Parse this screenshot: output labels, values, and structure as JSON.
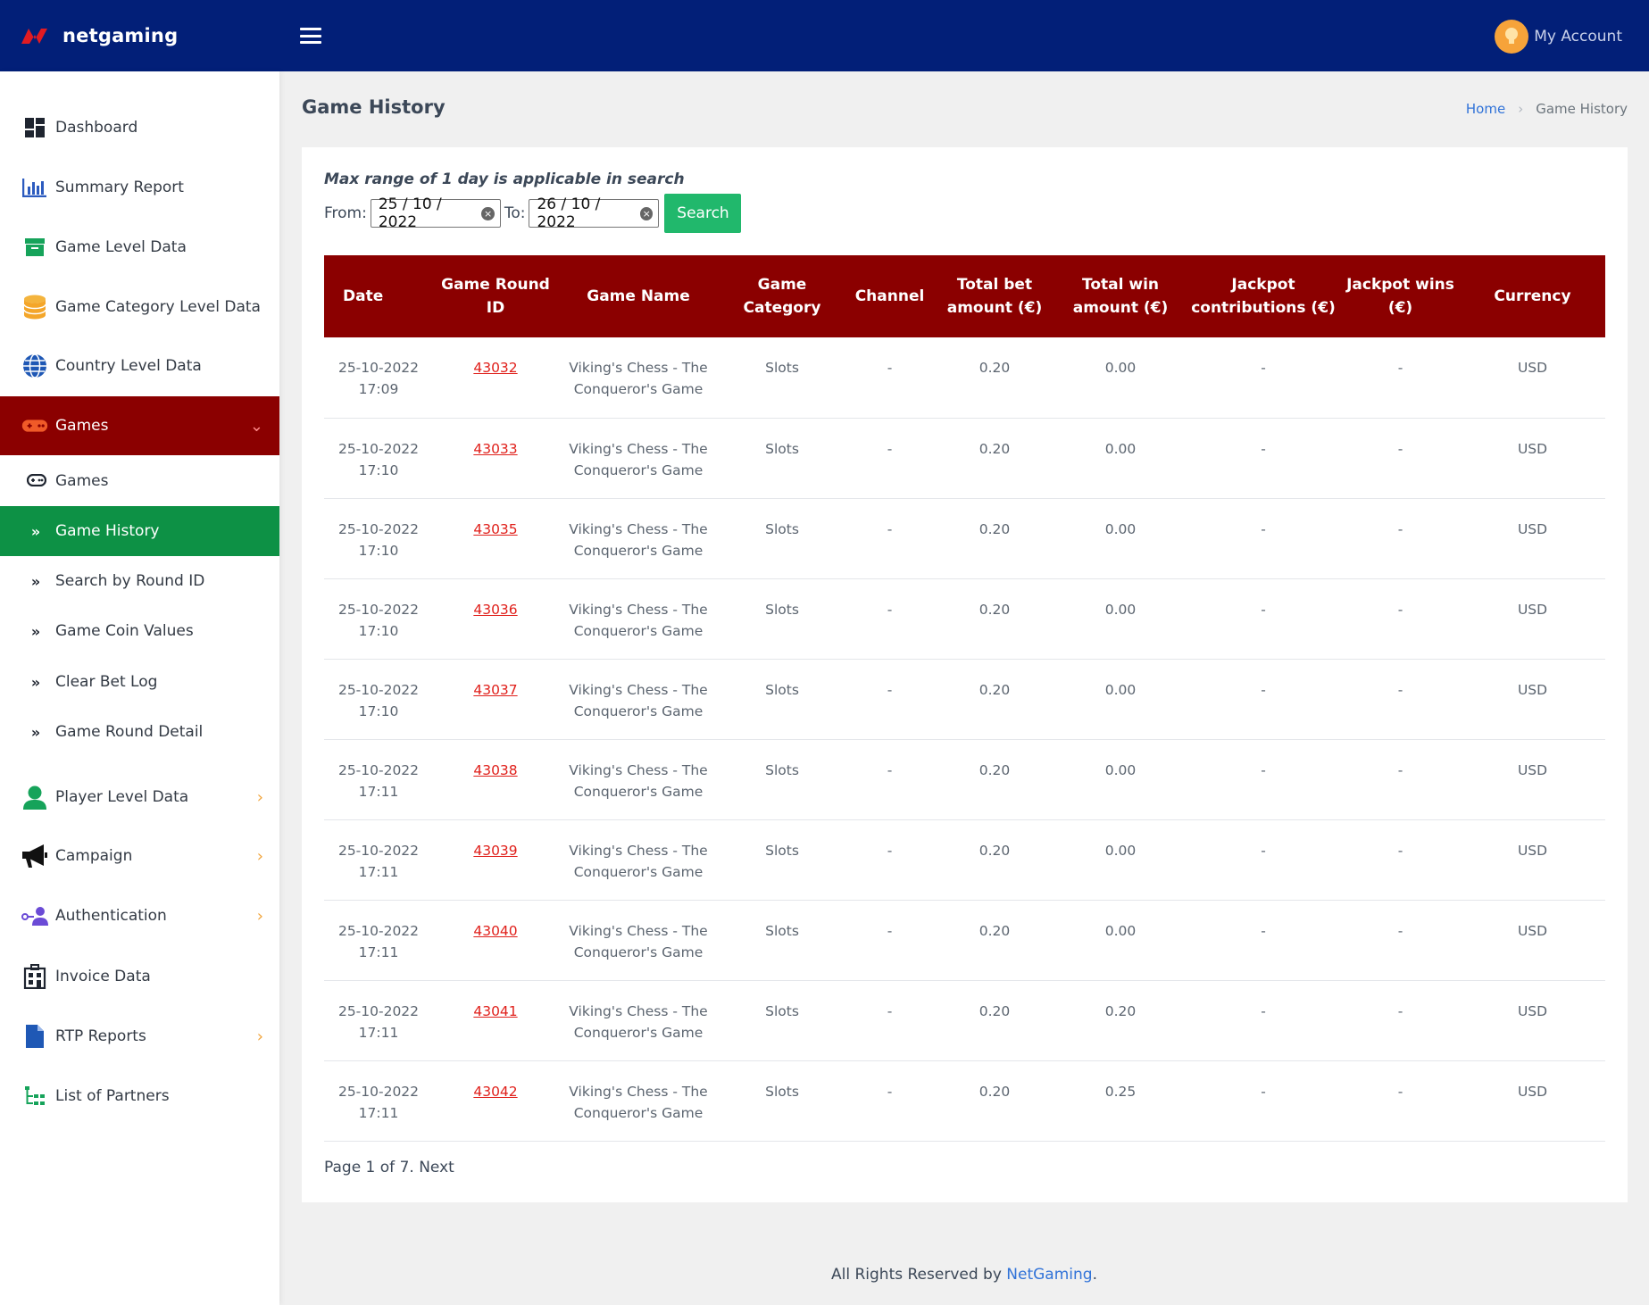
{
  "header": {
    "brand": "netgaming",
    "account_label": "My Account"
  },
  "sidebar": {
    "items": [
      {
        "label": "Dashboard",
        "icon": "dashboard-icon"
      },
      {
        "label": "Summary Report",
        "icon": "bar-chart-icon"
      },
      {
        "label": "Game Level Data",
        "icon": "archive-box-icon"
      },
      {
        "label": "Game Category Level Data",
        "icon": "database-icon"
      },
      {
        "label": "Country Level Data",
        "icon": "globe-icon"
      },
      {
        "label": "Games",
        "icon": "gamepad-icon"
      },
      {
        "label": "Player Level Data",
        "icon": "user-icon"
      },
      {
        "label": "Campaign",
        "icon": "megaphone-icon"
      },
      {
        "label": "Authentication",
        "icon": "user-key-icon"
      },
      {
        "label": "Invoice Data",
        "icon": "building-icon"
      },
      {
        "label": "RTP Reports",
        "icon": "document-icon"
      },
      {
        "label": "List of Partners",
        "icon": "sitemap-icon"
      }
    ],
    "sub_items": [
      {
        "label": "Games",
        "icon": "gamepad-icon"
      },
      {
        "label": "Game History",
        "icon": "double-chevron-icon"
      },
      {
        "label": "Search by Round ID",
        "icon": "double-chevron-icon"
      },
      {
        "label": "Game Coin Values",
        "icon": "double-chevron-icon"
      },
      {
        "label": "Clear Bet Log",
        "icon": "double-chevron-icon"
      },
      {
        "label": "Game Round Detail",
        "icon": "double-chevron-icon"
      }
    ]
  },
  "page": {
    "title": "Game History",
    "breadcrumb": {
      "home": "Home",
      "current": "Game History"
    }
  },
  "filters": {
    "hint": "Max range of 1 day is applicable in search",
    "from_label": "From:",
    "from_value": "25 / 10 / 2022",
    "to_label": "To:",
    "to_value": "26 / 10 / 2022",
    "search_label": "Search"
  },
  "table": {
    "headers": [
      "Date",
      "Game Round ID",
      "Game Name",
      "Game Category",
      "Channel",
      "Total bet amount (€)",
      "Total win amount (€)",
      "Jackpot contributions (€)",
      "Jackpot wins (€)",
      "Currency"
    ],
    "rows": [
      {
        "date": "25-10-2022",
        "time": "17:09",
        "round_id": "43032",
        "name_1": "Viking's Chess - The",
        "name_2": "Conqueror's Game",
        "category": "Slots",
        "channel": "-",
        "bet": "0.20",
        "win": "0.00",
        "jp_contrib": "-",
        "jp_wins": "-",
        "currency": "USD"
      },
      {
        "date": "25-10-2022",
        "time": "17:10",
        "round_id": "43033",
        "name_1": "Viking's Chess - The",
        "name_2": "Conqueror's Game",
        "category": "Slots",
        "channel": "-",
        "bet": "0.20",
        "win": "0.00",
        "jp_contrib": "-",
        "jp_wins": "-",
        "currency": "USD"
      },
      {
        "date": "25-10-2022",
        "time": "17:10",
        "round_id": "43035",
        "name_1": "Viking's Chess - The",
        "name_2": "Conqueror's Game",
        "category": "Slots",
        "channel": "-",
        "bet": "0.20",
        "win": "0.00",
        "jp_contrib": "-",
        "jp_wins": "-",
        "currency": "USD"
      },
      {
        "date": "25-10-2022",
        "time": "17:10",
        "round_id": "43036",
        "name_1": "Viking's Chess - The",
        "name_2": "Conqueror's Game",
        "category": "Slots",
        "channel": "-",
        "bet": "0.20",
        "win": "0.00",
        "jp_contrib": "-",
        "jp_wins": "-",
        "currency": "USD"
      },
      {
        "date": "25-10-2022",
        "time": "17:10",
        "round_id": "43037",
        "name_1": "Viking's Chess - The",
        "name_2": "Conqueror's Game",
        "category": "Slots",
        "channel": "-",
        "bet": "0.20",
        "win": "0.00",
        "jp_contrib": "-",
        "jp_wins": "-",
        "currency": "USD"
      },
      {
        "date": "25-10-2022",
        "time": "17:11",
        "round_id": "43038",
        "name_1": "Viking's Chess - The",
        "name_2": "Conqueror's Game",
        "category": "Slots",
        "channel": "-",
        "bet": "0.20",
        "win": "0.00",
        "jp_contrib": "-",
        "jp_wins": "-",
        "currency": "USD"
      },
      {
        "date": "25-10-2022",
        "time": "17:11",
        "round_id": "43039",
        "name_1": "Viking's Chess - The",
        "name_2": "Conqueror's Game",
        "category": "Slots",
        "channel": "-",
        "bet": "0.20",
        "win": "0.00",
        "jp_contrib": "-",
        "jp_wins": "-",
        "currency": "USD"
      },
      {
        "date": "25-10-2022",
        "time": "17:11",
        "round_id": "43040",
        "name_1": "Viking's Chess - The",
        "name_2": "Conqueror's Game",
        "category": "Slots",
        "channel": "-",
        "bet": "0.20",
        "win": "0.00",
        "jp_contrib": "-",
        "jp_wins": "-",
        "currency": "USD"
      },
      {
        "date": "25-10-2022",
        "time": "17:11",
        "round_id": "43041",
        "name_1": "Viking's Chess - The",
        "name_2": "Conqueror's Game",
        "category": "Slots",
        "channel": "-",
        "bet": "0.20",
        "win": "0.20",
        "jp_contrib": "-",
        "jp_wins": "-",
        "currency": "USD"
      },
      {
        "date": "25-10-2022",
        "time": "17:11",
        "round_id": "43042",
        "name_1": "Viking's Chess - The",
        "name_2": "Conqueror's Game",
        "category": "Slots",
        "channel": "-",
        "bet": "0.20",
        "win": "0.25",
        "jp_contrib": "-",
        "jp_wins": "-",
        "currency": "USD"
      }
    ]
  },
  "pagination": {
    "status": "Page 1 of 7.",
    "next": "Next"
  },
  "footer": {
    "text": "All Rights Reserved by",
    "brand": "NetGaming",
    "period": "."
  },
  "colors": {
    "topbar": "#021f78",
    "menu_open": "#8b0000",
    "menu_active": "#0d9145",
    "table_header": "#8b0000",
    "link": "#e0201b",
    "search_button": "#21b86c"
  }
}
